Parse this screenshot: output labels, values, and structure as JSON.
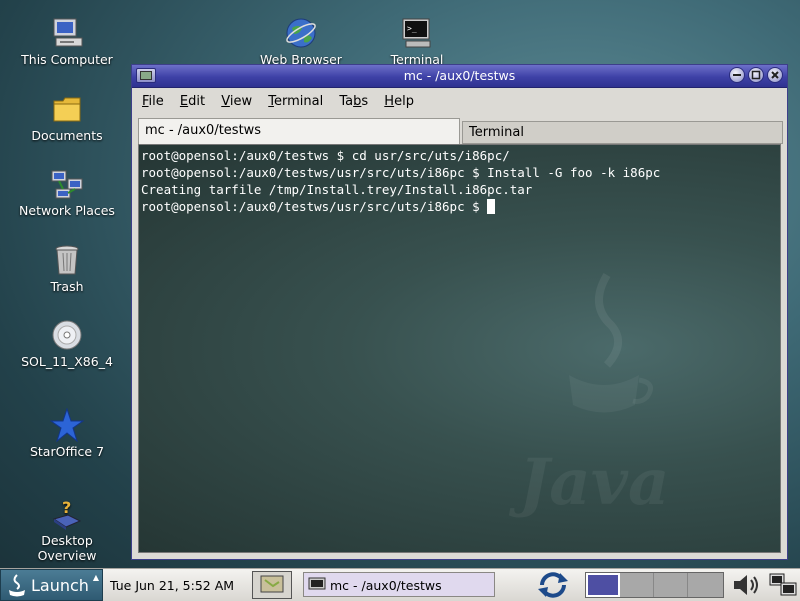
{
  "desktop": {
    "icons": [
      {
        "label": "This Computer",
        "icon": "computer-icon"
      },
      {
        "label": "Documents",
        "icon": "folder-icon"
      },
      {
        "label": "Network Places",
        "icon": "network-icon"
      },
      {
        "label": "Trash",
        "icon": "trash-icon"
      },
      {
        "label": "SOL_11_X86_4",
        "icon": "cd-icon"
      },
      {
        "label": "StarOffice 7",
        "icon": "staroffice-icon"
      },
      {
        "label": "Desktop Overview",
        "icon": "help-book-icon"
      },
      {
        "label": "Web Browser",
        "icon": "globe-icon"
      },
      {
        "label": "Terminal",
        "icon": "terminal-icon"
      }
    ]
  },
  "window": {
    "title": "mc - /aux0/testws",
    "menu": [
      {
        "pre": "",
        "key": "F",
        "post": "ile"
      },
      {
        "pre": "",
        "key": "E",
        "post": "dit"
      },
      {
        "pre": "",
        "key": "V",
        "post": "iew"
      },
      {
        "pre": "",
        "key": "T",
        "post": "erminal"
      },
      {
        "pre": "Ta",
        "key": "b",
        "post": "s"
      },
      {
        "pre": "",
        "key": "H",
        "post": "elp"
      }
    ],
    "tabs": [
      "mc - /aux0/testws",
      "Terminal"
    ],
    "terminal_lines": [
      "root@opensol:/aux0/testws $ cd usr/src/uts/i86pc/",
      "root@opensol:/aux0/testws/usr/src/uts/i86pc $ Install -G foo -k i86pc",
      "Creating tarfile /tmp/Install.trey/Install.i86pc.tar",
      "root@opensol:/aux0/testws/usr/src/uts/i86pc $ "
    ]
  },
  "taskbar": {
    "launch_label": "Launch",
    "clock": "Tue Jun 21,  5:52 AM",
    "task_label": "mc - /aux0/testws",
    "workspaces": 4,
    "active_workspace": 1
  },
  "colors": {
    "titlebar": "#3e41a6",
    "launch": "#2f5a72"
  }
}
